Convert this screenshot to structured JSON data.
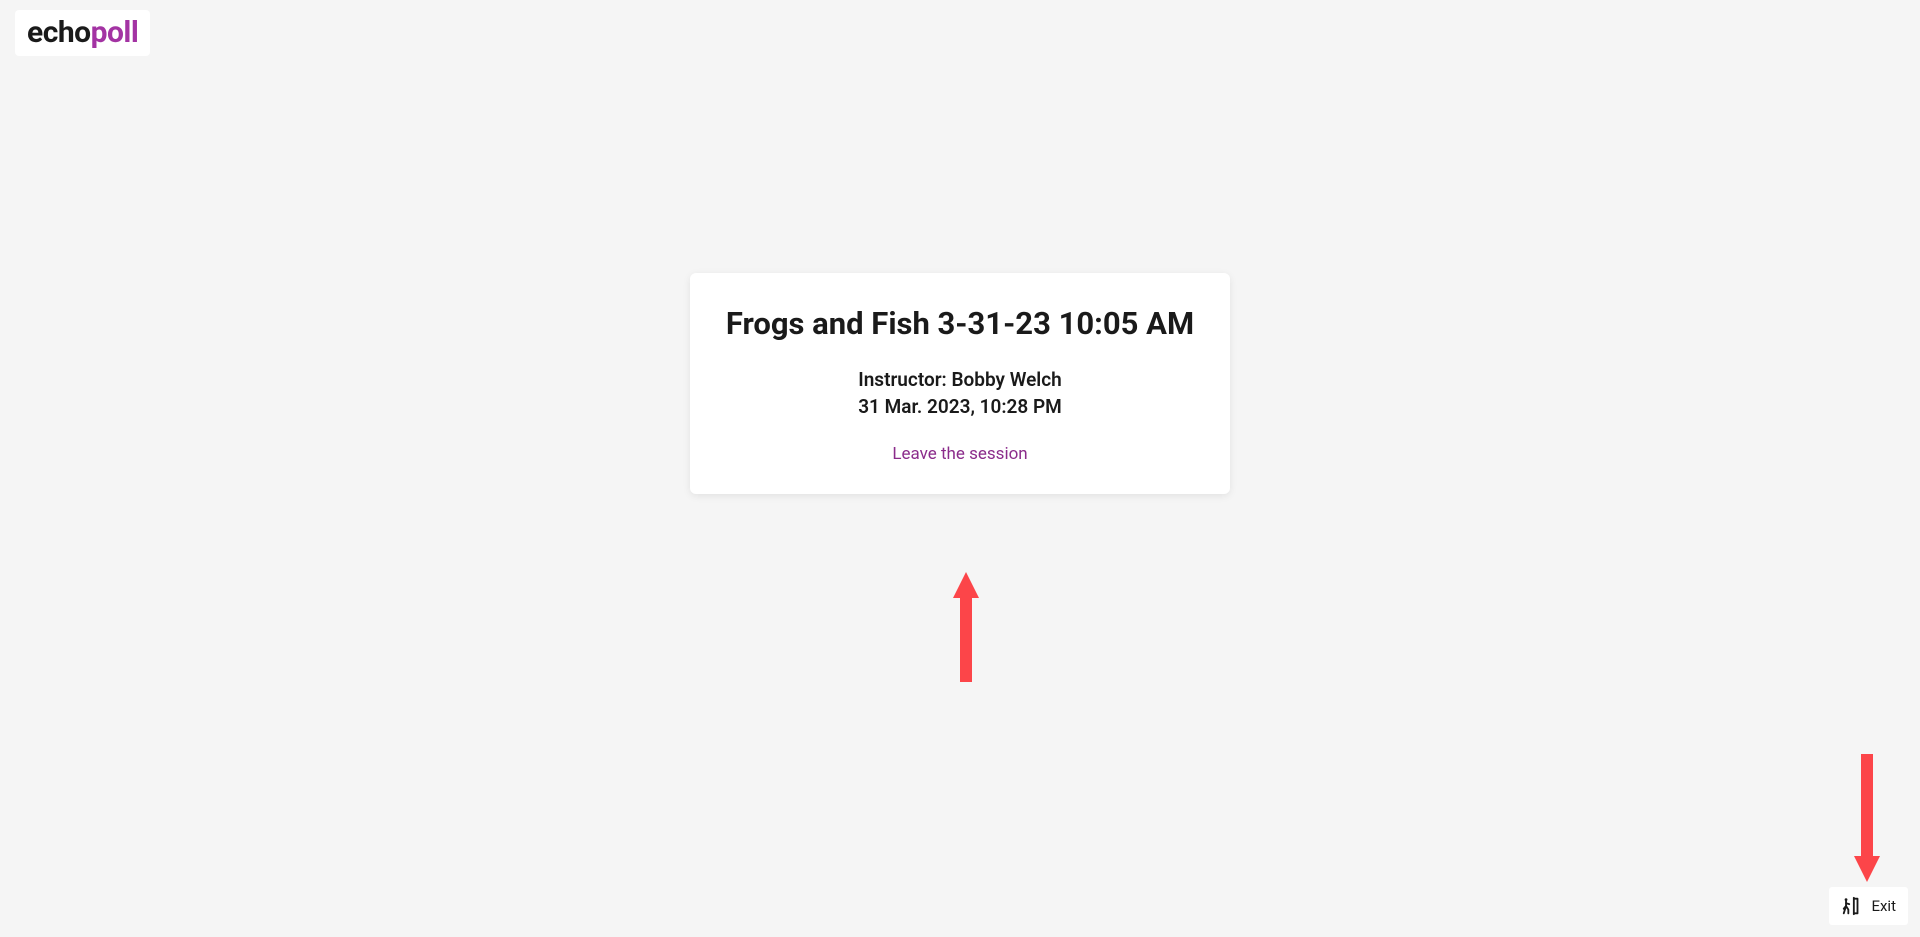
{
  "brand": {
    "part1": "echo",
    "part2": "poll"
  },
  "session": {
    "title": "Frogs and Fish 3-31-23 10:05 AM",
    "instructor_line": "Instructor: Bobby Welch",
    "datetime": "31 Mar. 2023, 10:28 PM",
    "leave_label": "Leave the session"
  },
  "exit": {
    "label": "Exit"
  },
  "colors": {
    "accent_purple": "#8b2c8b",
    "annotation_red": "#fc4549",
    "card_bg": "#ffffff",
    "page_bg": "#f5f5f5"
  }
}
